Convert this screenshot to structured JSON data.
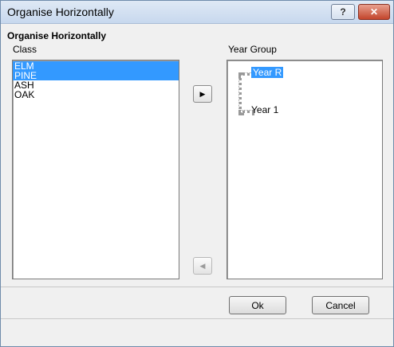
{
  "window": {
    "title": "Organise Horizontally"
  },
  "titlebar": {
    "help_glyph": "?",
    "close_glyph": "✕"
  },
  "panel": {
    "heading": "Organise Horizontally",
    "class_label": "Class",
    "year_group_label": "Year Group"
  },
  "class_list": [
    {
      "label": "ELM",
      "selected": true
    },
    {
      "label": "PINE",
      "selected": true
    },
    {
      "label": "ASH",
      "selected": false
    },
    {
      "label": "OAK",
      "selected": false
    }
  ],
  "year_group_tree": [
    {
      "label": "Year  R",
      "selected": true
    },
    {
      "label": "Year 1",
      "selected": false
    }
  ],
  "buttons": {
    "move_right_glyph": "▶",
    "move_left_glyph": "◀",
    "ok": "Ok",
    "cancel": "Cancel"
  },
  "colors": {
    "selection": "#3399ff",
    "close_button": "#c3452c"
  }
}
